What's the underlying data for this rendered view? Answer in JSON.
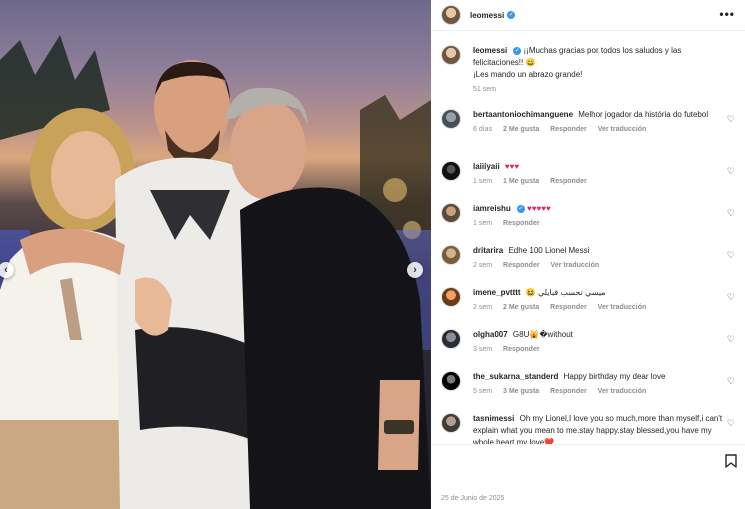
{
  "post": {
    "username": "leomessi",
    "verified_mark": "✓",
    "more_label": "•••",
    "date": "25 de Junio de 2025",
    "nav_prev": "‹",
    "nav_next": "›"
  },
  "caption": {
    "username": "leomessi",
    "text_line1": "¡¡Muchas gracias por todos los saludos y las felicitaciones!! 😀",
    "text_line2": "¡Les mando un abrazo grande!",
    "time": "51 sem"
  },
  "comments": [
    {
      "username": "bertaantoniochimanguene",
      "text": "Melhor jogador da história do futebol",
      "time": "6 días",
      "likes": "2 Me gusta",
      "reply": "Responder",
      "translate": "Ver traducción"
    },
    {
      "username": "laiiiyaii",
      "text": "♥♥♥",
      "time": "1 sem",
      "likes": "1 Me gusta",
      "reply": "Responder",
      "translate": ""
    },
    {
      "username": "iamreishu",
      "text": "♥♥♥♥♥",
      "time": "1 sem",
      "likes": "",
      "reply": "Responder",
      "translate": ""
    },
    {
      "username": "dritarira",
      "text": "Edhe 100 Lionel Messi",
      "time": "2 sem",
      "likes": "",
      "reply": "Responder",
      "translate": "Ver traducción"
    },
    {
      "username": "imene_pvtttt",
      "text": "😆 ميسي تحسب قبايلي",
      "time": "2 sem",
      "likes": "2 Me gusta",
      "reply": "Responder",
      "translate": "Ver traducción"
    },
    {
      "username": "olgha007",
      "text": "G8U🙀�without",
      "time": "3 sem",
      "likes": "",
      "reply": "Responder",
      "translate": ""
    },
    {
      "username": "the_sukarna_standerd",
      "text": "Happy birthday my dear love",
      "time": "5 sem",
      "likes": "3 Me gusta",
      "reply": "Responder",
      "translate": "Ver traducción"
    },
    {
      "username": "tasnimessi",
      "text": "Oh my Lionel,I love you so much,more than myself,i can't explain what you mean to me.stay happy.stay blessed,you have my whole heart my love❤️",
      "time": "",
      "likes": "",
      "reply": "",
      "translate": ""
    }
  ],
  "icons": {
    "heart": "heart-outline-icon",
    "bookmark": "bookmark-icon",
    "more": "more-options-icon"
  },
  "colors": {
    "verified": "#3897f0",
    "heart_red": "#e0245e",
    "meta_gray": "#8e8e8e"
  }
}
